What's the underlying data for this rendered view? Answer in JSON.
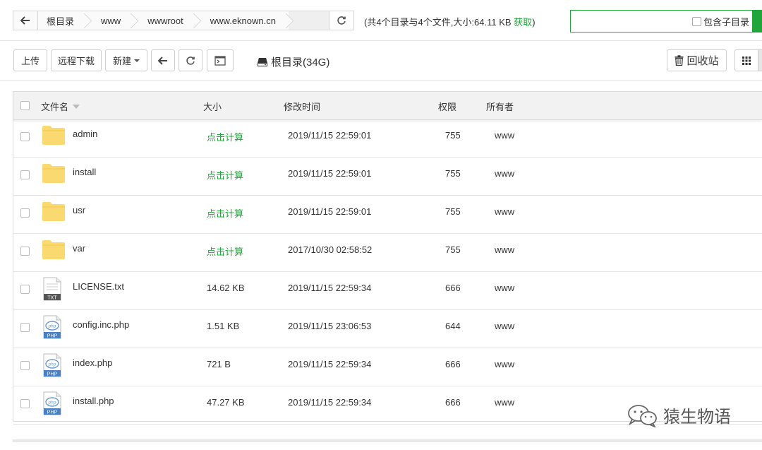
{
  "path": {
    "crumbs": [
      "根目录",
      "www",
      "wwwroot",
      "www.eknown.cn"
    ]
  },
  "summary": {
    "text": "(共4个目录与4个文件,大小:64.11 KB",
    "fetch": "获取",
    "close": ")"
  },
  "search": {
    "placeholder": "",
    "subdir_label": "包含子目录"
  },
  "toolbar": {
    "upload": "上传",
    "remote_download": "远程下载",
    "new": "新建",
    "disk_label": "根目录(34G)",
    "recycle": "回收站"
  },
  "table": {
    "headers": {
      "name": "文件名",
      "size": "大小",
      "mtime": "修改时间",
      "perm": "权限",
      "owner": "所有者"
    },
    "rows": [
      {
        "name": "admin",
        "type": "folder",
        "size": "点击计算",
        "mtime": "2019/11/15 22:59:01",
        "perm": "755",
        "owner": "www"
      },
      {
        "name": "install",
        "type": "folder",
        "size": "点击计算",
        "mtime": "2019/11/15 22:59:01",
        "perm": "755",
        "owner": "www"
      },
      {
        "name": "usr",
        "type": "folder",
        "size": "点击计算",
        "mtime": "2019/11/15 22:59:01",
        "perm": "755",
        "owner": "www"
      },
      {
        "name": "var",
        "type": "folder",
        "size": "点击计算",
        "mtime": "2017/10/30 02:58:52",
        "perm": "755",
        "owner": "www"
      },
      {
        "name": "LICENSE.txt",
        "type": "txt",
        "size": "14.62 KB",
        "mtime": "2019/11/15 22:59:34",
        "perm": "666",
        "owner": "www"
      },
      {
        "name": "config.inc.php",
        "type": "php",
        "size": "1.51 KB",
        "mtime": "2019/11/15 23:06:53",
        "perm": "644",
        "owner": "www"
      },
      {
        "name": "index.php",
        "type": "php",
        "size": "721 B",
        "mtime": "2019/11/15 22:59:34",
        "perm": "666",
        "owner": "www"
      },
      {
        "name": "install.php",
        "type": "php",
        "size": "47.27 KB",
        "mtime": "2019/11/15 22:59:34",
        "perm": "666",
        "owner": "www"
      }
    ]
  },
  "icon_labels": {
    "txt": "TXT",
    "php_badge": "PHP",
    "php_text": "php"
  },
  "watermark": "猿生物语",
  "colors": {
    "accent": "#20a53a",
    "folder": "#fbd971"
  }
}
